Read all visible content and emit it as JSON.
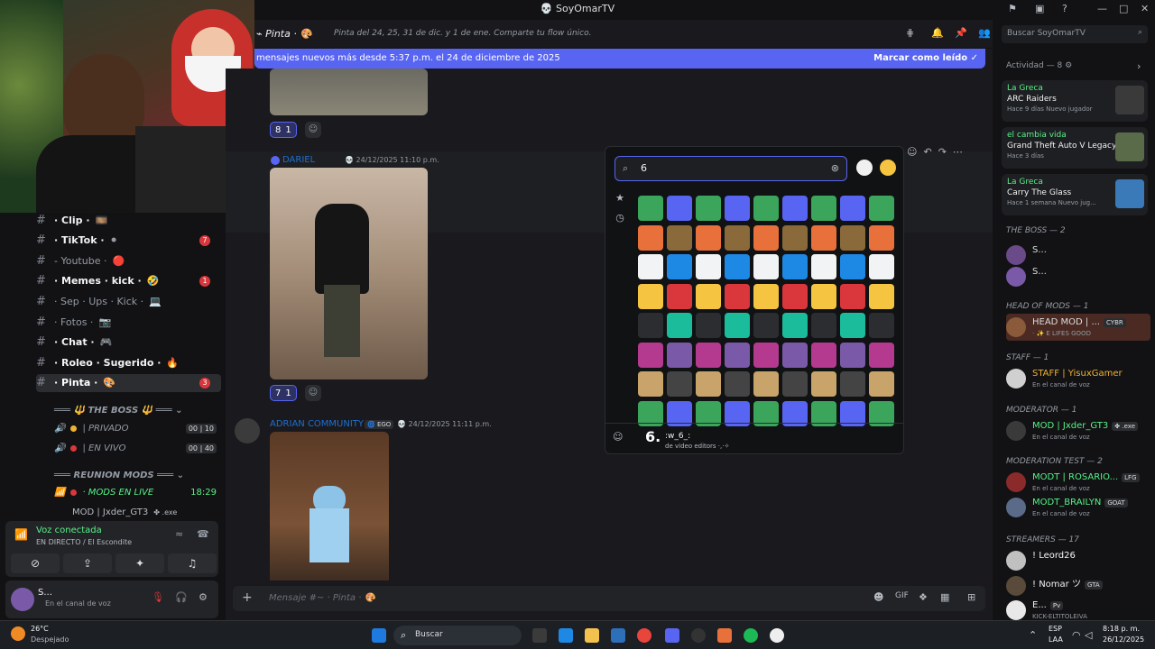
{
  "window": {
    "title": "SoyOmarTV"
  },
  "channels": [
    {
      "name": "· Clip ·",
      "emoji": "🎞️",
      "unread": true,
      "badge": ""
    },
    {
      "name": "· TikTok ·",
      "emoji": "⚫",
      "unread": true,
      "badge": "7"
    },
    {
      "name": "- Youtube ·",
      "emoji": "🔴",
      "unread": false,
      "badge": ""
    },
    {
      "name": "· Memes · kick ·",
      "emoji": "🤣",
      "unread": true,
      "badge": "1"
    },
    {
      "name": "· Sep · Ups · Kick ·",
      "emoji": "💻",
      "unread": false,
      "badge": ""
    },
    {
      "name": "· Fotos ·",
      "emoji": "📷",
      "unread": false,
      "badge": ""
    },
    {
      "name": "· Chat ·",
      "emoji": "🎮",
      "unread": true,
      "badge": ""
    },
    {
      "name": "· Roleo · Sugerido ·",
      "emoji": "🔥",
      "unread": true,
      "badge": ""
    },
    {
      "name": "· Pinta ·",
      "emoji": "🎨",
      "unread": true,
      "badge": "3"
    }
  ],
  "boss_category": "THE BOSS",
  "voice_rooms": [
    {
      "name": "| PRIVADO",
      "count_a": "00",
      "count_b": "10"
    },
    {
      "name": "| EN VIVO",
      "count_a": "00",
      "count_b": "40"
    }
  ],
  "reunion": {
    "category": "REUNION MODS",
    "channel": "· MODS EN LIVE",
    "time": "18:29",
    "member": "MOD | Jxder_GT3",
    "member_tag": "✤ .exe"
  },
  "voice_panel": {
    "status": "Voz conectada",
    "detail": "EN DIRECTO",
    "room": "/ El Escondite"
  },
  "user_panel": {
    "name": "S...",
    "status": "En el canal de voz"
  },
  "header": {
    "channel": "Pinta",
    "emoji": "🎨",
    "topic": "Pinta del 24, 25, 31 de dic. y 1 de ene. Comparte tu flow único."
  },
  "new_messages": {
    "text": "mensajes nuevos más desde 5:37 p.m. el 24 de diciembre de 2025",
    "mark_read": "Marcar como leído"
  },
  "messages": [
    {
      "author": "DARIEL",
      "time": "24/12/2025 11:10 p.m."
    },
    {
      "author": "ADRIAN COMMUNITY",
      "tag": "EGO",
      "time": "24/12/2025 11:11 p.m."
    }
  ],
  "reactions": [
    {
      "emoji": "8",
      "count": "1"
    },
    {
      "emoji": "7",
      "count": "1"
    }
  ],
  "composer": {
    "placeholder": "Mensaje #~ · Pinta ·",
    "emoji": "🎨"
  },
  "picker": {
    "query": "6",
    "hover_name": ":w_6_:",
    "hover_source": "de video editors ·,·✧"
  },
  "right": {
    "search": "Buscar SoyOmarTV",
    "activity_title": "Actividad — 8",
    "activities": [
      {
        "who": "La Greca",
        "game": "ARC Raiders",
        "time": "Hace 9 días",
        "note": "Nuevo jugador",
        "color": "#3a3a3a"
      },
      {
        "who": "el cambia vida",
        "game": "Grand Theft Auto V Legacy",
        "time": "Hace 3 días",
        "note": "",
        "color": "#5a6b4a"
      },
      {
        "who": "La Greca",
        "game": "Carry The Glass",
        "time": "Hace 1 semana",
        "note": "Nuevo jug...",
        "color": "#3b7ab8"
      }
    ],
    "sections": [
      {
        "title": "THE BOSS — 2"
      },
      {
        "title": "HEAD OF MODS — 1"
      },
      {
        "title": "STAFF — 1"
      },
      {
        "title": "MODERATOR — 1"
      },
      {
        "title": "MODERATION TEST — 2"
      },
      {
        "title": "STREAMERS — 17"
      }
    ],
    "members": [
      {
        "name": "S...",
        "status": "",
        "color": "#dbdee1",
        "tag": ""
      },
      {
        "name": "S...",
        "status": "",
        "color": "#dbdee1",
        "tag": ""
      },
      {
        "name": "HEAD MOD | ...",
        "status": "· ✨ E LIFES GOOD",
        "color": "#dbdee1",
        "tag": "CYBR"
      },
      {
        "name": "STAFF | YisuxGamer",
        "status": "En el canal de voz",
        "color": "#f0b232",
        "tag": ""
      },
      {
        "name": "MOD | Jxder_GT3",
        "status": "En el canal de voz",
        "color": "#57f287",
        "tag": "✤ .exe"
      },
      {
        "name": "MODT | ROSARIO...",
        "status": "En el canal de voz",
        "color": "#57f287",
        "tag": "LFG"
      },
      {
        "name": "MODT_BRAILYN",
        "status": "En el canal de voz",
        "color": "#57f287",
        "tag": "GOAT"
      },
      {
        "name": "! Leord26",
        "status": "",
        "color": "#f2f3f5",
        "tag": ""
      },
      {
        "name": "! Nomar ツ",
        "status": "",
        "color": "#f2f3f5",
        "tag": "GTA"
      },
      {
        "name": "E...",
        "status": "KICK-ELTITOLEIVA",
        "color": "#f2f3f5",
        "tag": "Pv"
      }
    ]
  },
  "taskbar": {
    "weather_temp": "26°C",
    "weather_desc": "Despejado",
    "search": "Buscar",
    "lang": "ESP",
    "lang2": "LAA",
    "time": "8:18 p. m.",
    "date": "26/12/2025"
  }
}
